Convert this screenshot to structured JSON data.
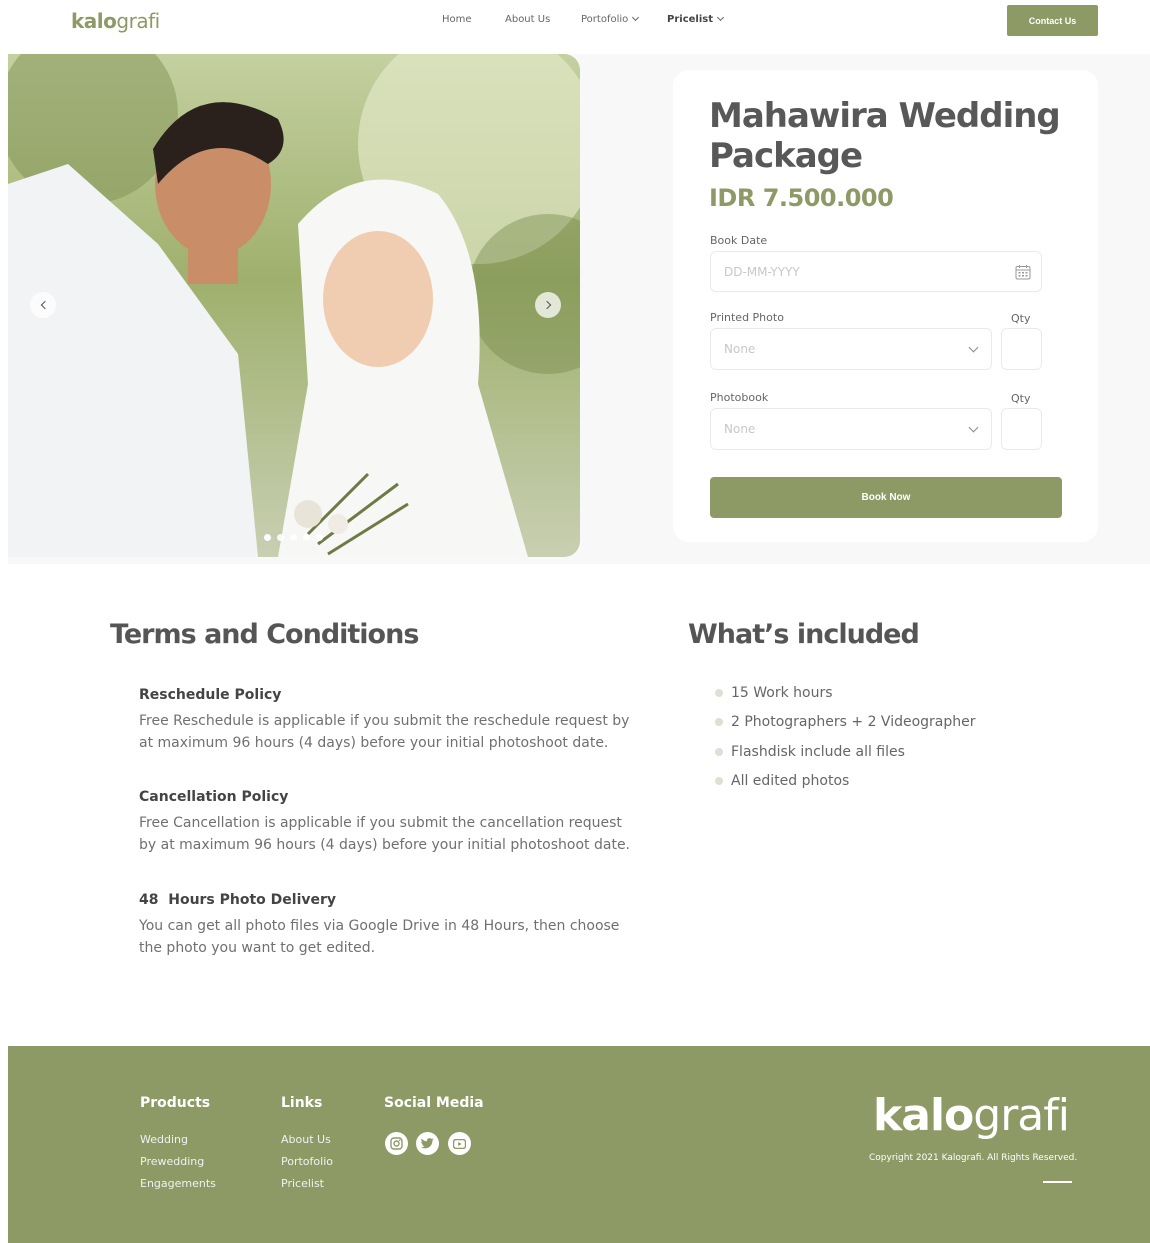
{
  "nav": {
    "logo_bold": "kalo",
    "logo_light": "grafi",
    "links": [
      "Home",
      "About Us",
      "Portofolio",
      "Pricelist"
    ],
    "contact": "Contact Us"
  },
  "hero": {
    "slides": 5,
    "active_slide": 0
  },
  "booking": {
    "title": "Mahawira Wedding Package",
    "price": "IDR 7.500.000",
    "book_date_label": "Book Date",
    "book_date_placeholder": "DD-MM-YYYY",
    "printed_photo_label": "Printed Photo",
    "printed_photo_value": "None",
    "photobook_label": "Photobook",
    "photobook_value": "None",
    "qty_label": "Qty",
    "button": "Book Now"
  },
  "terms": {
    "heading": "Terms and Conditions",
    "policies": [
      {
        "title": "Reschedule Policy",
        "text": "Free Reschedule is applicable if you submit the reschedule request by at maximum 96 hours (4 days) before your initial photoshoot date."
      },
      {
        "title": "Cancellation Policy",
        "text": "Free Cancellation is applicable if you submit the cancellation request by at maximum 96 hours (4 days) before your initial photoshoot date."
      },
      {
        "title": "48  Hours Photo Delivery",
        "text": "You can get all photo files via Google Drive in 48 Hours, then choose the photo you want to get edited."
      }
    ]
  },
  "included": {
    "heading": "What’s included",
    "items": [
      "15 Work hours",
      "2 Photographers + 2 Videographer",
      "Flashdisk include all files",
      "All edited photos"
    ]
  },
  "footer": {
    "products_heading": "Products",
    "products": [
      "Wedding",
      "Prewedding",
      "Engagements"
    ],
    "links_heading": "Links",
    "links": [
      "About Us",
      "Portofolio",
      "Pricelist"
    ],
    "social_heading": "Social Media",
    "social": [
      "instagram-icon",
      "twitter-icon",
      "youtube-icon"
    ],
    "logo_bold": "kalo",
    "logo_light": "grafi",
    "copyright": "Copyright 2021 Kalografi. All Rights Reserved."
  },
  "colors": {
    "accent": "#8e9a66",
    "text": "#555555"
  }
}
